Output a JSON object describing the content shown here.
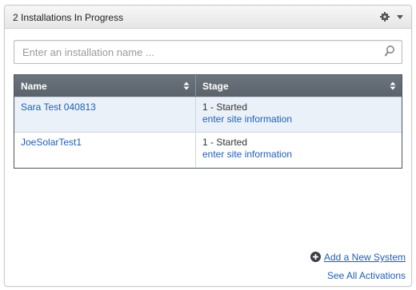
{
  "panel": {
    "title": "2 Installations In Progress",
    "icons": {
      "settings": "gear-icon",
      "menu": "chevron-down-icon"
    }
  },
  "search": {
    "placeholder": "Enter an installation name ...",
    "value": "",
    "icon": "search-icon"
  },
  "table": {
    "columns": [
      "Name",
      "Stage"
    ],
    "rows": [
      {
        "name": "Sara Test 040813",
        "stage": "1 - Started",
        "action": "enter site information"
      },
      {
        "name": "JoeSolarTest1",
        "stage": "1 - Started",
        "action": "enter site information"
      }
    ]
  },
  "footer": {
    "add_label": "Add a New System",
    "see_all_label": "See All Activations"
  },
  "colors": {
    "link": "#1f5fb3",
    "table_header": "#5f6870",
    "selected_row": "#eaf1f9"
  }
}
